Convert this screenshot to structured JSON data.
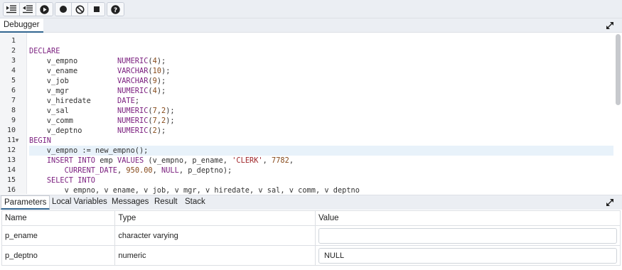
{
  "toolbar": {
    "icons": [
      "step-into-icon",
      "step-over-icon",
      "continue-icon",
      "toggle-breakpoint-icon",
      "clear-breakpoints-icon",
      "stop-icon",
      "help-icon"
    ]
  },
  "debugger": {
    "tab_label": "Debugger"
  },
  "code": {
    "line_numbers": [
      "1",
      "2",
      "3",
      "4",
      "5",
      "6",
      "7",
      "8",
      "9",
      "10",
      "11",
      "12",
      "13",
      "14",
      "15",
      "16"
    ]
  },
  "panel": {
    "tabs": [
      "Parameters",
      "Local Variables",
      "Messages",
      "Result",
      "Stack"
    ],
    "active_tab": "Parameters"
  },
  "params_table": {
    "headers": [
      "Name",
      "Type",
      "Value"
    ],
    "rows": [
      {
        "name": "p_ename",
        "type": "character varying",
        "value": ""
      },
      {
        "name": "p_deptno",
        "type": "numeric",
        "value": "NULL"
      }
    ]
  },
  "colors": {
    "keyword": "#7a1e7e",
    "number": "#874a1a",
    "string": "#a0272b",
    "active_tab_border": "#326690",
    "toolbar_bg": "#ebeef3"
  }
}
